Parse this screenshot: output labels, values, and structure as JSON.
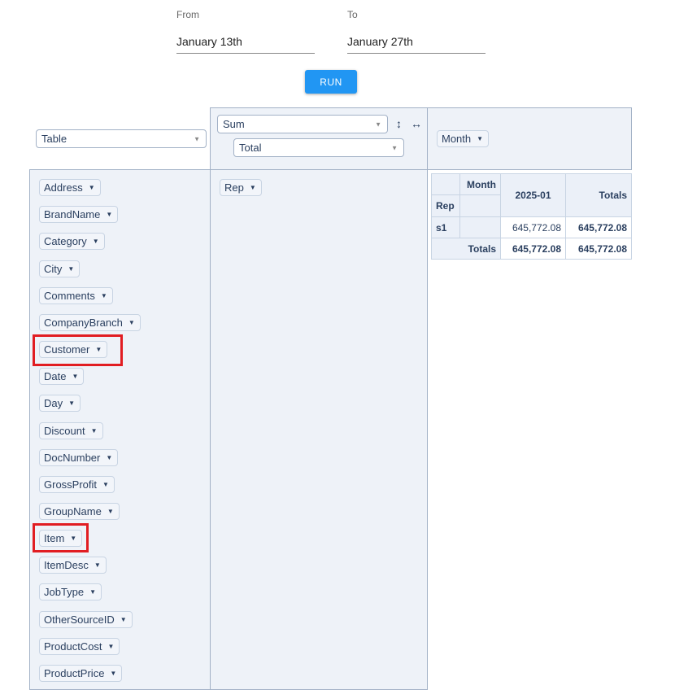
{
  "date_range": {
    "from_label": "From",
    "from_value": "January 13th",
    "to_label": "To",
    "to_value": "January 27th"
  },
  "run_button": {
    "label": "RUN"
  },
  "pivot": {
    "renderer": {
      "selected": "Table"
    },
    "aggregator": {
      "selected": "Sum"
    },
    "value_field": {
      "selected": "Total"
    },
    "column_fields": [
      "Month"
    ],
    "row_fields": [
      "Rep"
    ],
    "attributes": [
      "Address",
      "BrandName",
      "Category",
      "City",
      "Comments",
      "CompanyBranch",
      "Customer",
      "Date",
      "Day",
      "Discount",
      "DocNumber",
      "GrossProfit",
      "GroupName",
      "Item",
      "ItemDesc",
      "JobType",
      "OtherSourceID",
      "ProductCost",
      "ProductPrice"
    ],
    "highlighted_attributes": [
      "Customer",
      "Item"
    ],
    "table": {
      "col_attr_label": "Month",
      "row_attr_label": "Rep",
      "col_headers": [
        "2025-01"
      ],
      "totals_label": "Totals",
      "rows": [
        {
          "label": "s1",
          "values": [
            "645,772.08"
          ],
          "total": "645,772.08"
        }
      ],
      "col_totals": [
        "645,772.08"
      ],
      "grand_total": "645,772.08"
    }
  }
}
